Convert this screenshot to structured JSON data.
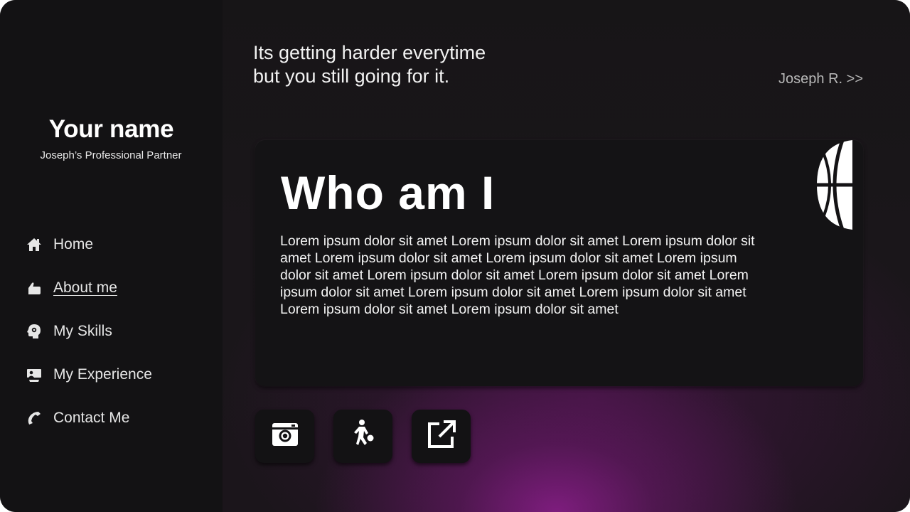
{
  "sidebar": {
    "brand_name": "Your name",
    "brand_subtitle": "Joseph’s Professional Partner",
    "items": [
      {
        "label": "Home",
        "icon": "home-icon"
      },
      {
        "label": "About me",
        "icon": "hand-icon",
        "active": true
      },
      {
        "label": "My Skills",
        "icon": "brain-gear-icon"
      },
      {
        "label": "My Experience",
        "icon": "presenter-icon"
      },
      {
        "label": "Contact Me",
        "icon": "phone-icon"
      }
    ]
  },
  "header": {
    "quote_line1": "Its getting harder everytime",
    "quote_line2": "but you still going for it.",
    "author": "Joseph R. >>"
  },
  "card": {
    "title": "Who am I",
    "body": "Lorem ipsum dolor sit amet Lorem ipsum dolor sit amet Lorem ipsum dolor sit amet Lorem ipsum dolor sit amet Lorem ipsum dolor sit amet Lorem ipsum dolor sit amet Lorem ipsum dolor sit amet Lorem ipsum dolor sit amet Lorem ipsum dolor sit amet Lorem ipsum dolor sit amet Lorem ipsum dolor sit amet Lorem ipsum dolor sit amet Lorem ipsum dolor sit amet",
    "icon": "basketball-icon"
  },
  "actions": [
    {
      "icon": "instagram-icon"
    },
    {
      "icon": "basketball-player-icon"
    },
    {
      "icon": "external-link-icon"
    }
  ],
  "colors": {
    "background": "#161416",
    "sidebar": "#131214",
    "card": "#141315",
    "accent_glow": "#8c1e8c",
    "text": "#ffffff",
    "muted": "#b8b8b8"
  }
}
